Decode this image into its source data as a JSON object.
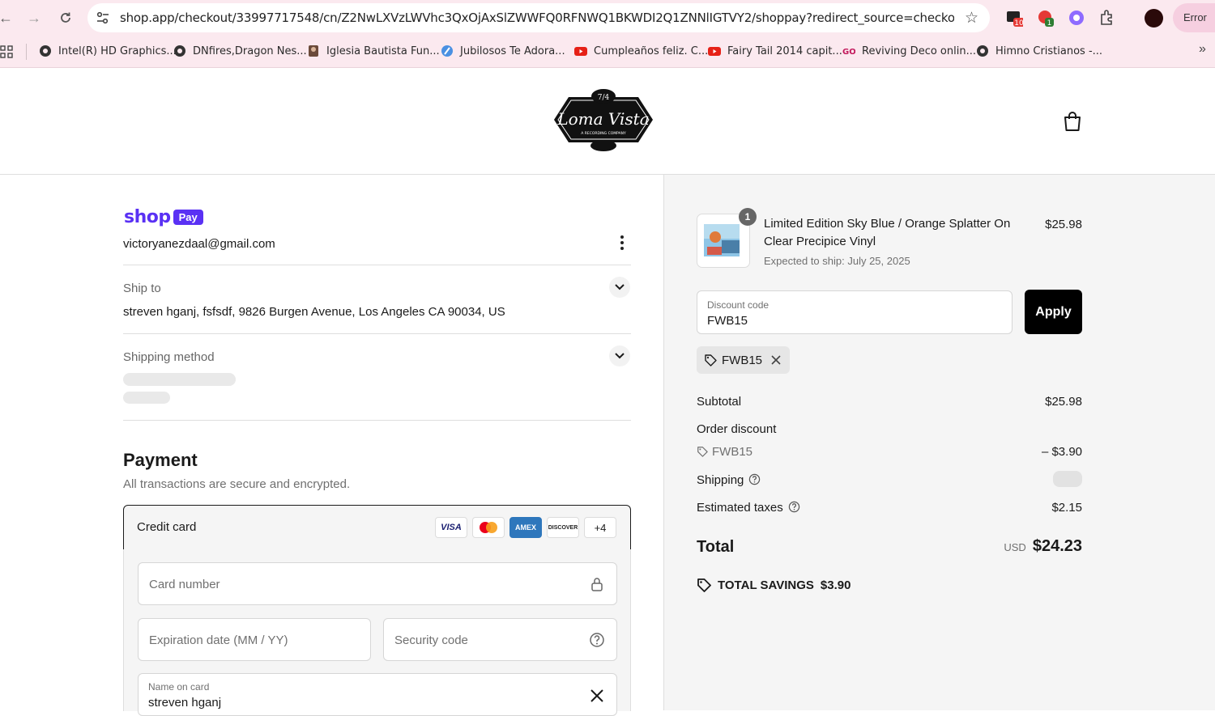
{
  "browser": {
    "url": "shop.app/checkout/33997717548/cn/Z2NwLXVzLWVhc3QxOjAxSlZWWFQ0RFNWQ1BKWDI2Q1ZNNlIGTVY2/shoppay?redirect_source=checkout_automa...",
    "error_label": "Error",
    "ext_badge_1": "10",
    "ext_badge_2": "1",
    "bookmarks": [
      "Intel(R) HD Graphics...",
      "DNfires,Dragon Nes...",
      "Iglesia Bautista Fun...",
      "Jubilosos Te Adora...",
      "Cumpleaños feliz. C...",
      "Fairy Tail 2014 capit...",
      "Reviving Deco onlin...",
      "Himno Cristianos -..."
    ]
  },
  "store": {
    "logo_top": "7/4",
    "logo_name": "Loma Vista",
    "logo_sub": "A RECORDING COMPANY"
  },
  "checkout": {
    "shoppay_word": "shop",
    "shoppay_badge": "Pay",
    "email": "victoryanezdaal@gmail.com",
    "ship_to_label": "Ship to",
    "ship_to_value": "streven hganj, fsfsdf, 9826 Burgen Avenue, Los Angeles CA 90034, US",
    "shipping_method_label": "Shipping method",
    "payment_title": "Payment",
    "payment_sub": "All transactions are secure and encrypted.",
    "credit_card_label": "Credit card",
    "card_brands": [
      "VISA",
      "MC",
      "AMEX",
      "DISCOVER"
    ],
    "more_brands": "+4",
    "card_number_placeholder": "Card number",
    "expiry_placeholder": "Expiration date (MM / YY)",
    "security_placeholder": "Security code",
    "name_label": "Name on card",
    "name_value": "streven hganj"
  },
  "summary": {
    "item_qty": "1",
    "item_title": "Limited Edition Sky Blue / Orange Splatter On Clear Precipice Vinyl",
    "item_ship": "Expected to ship: July 25, 2025",
    "item_price": "$25.98",
    "discount_label": "Discount code",
    "discount_value": "FWB15",
    "apply_label": "Apply",
    "applied_code": "FWB15",
    "subtotal_label": "Subtotal",
    "subtotal_value": "$25.98",
    "order_discount_label": "Order discount",
    "order_discount_code": "FWB15",
    "order_discount_value": "– $3.90",
    "shipping_label": "Shipping",
    "taxes_label": "Estimated taxes",
    "taxes_value": "$2.15",
    "total_label": "Total",
    "total_currency": "USD",
    "total_value": "$24.23",
    "savings_label": "TOTAL SAVINGS",
    "savings_value": "$3.90"
  }
}
